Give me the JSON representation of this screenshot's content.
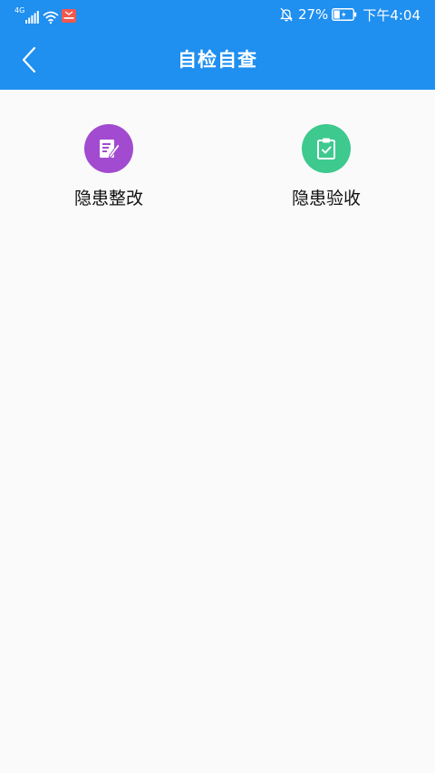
{
  "status_bar": {
    "network": "4G",
    "battery_percent": "27%",
    "time": "下午4:04",
    "icons": [
      "signal-icon",
      "wifi-icon",
      "app-badge-icon",
      "bell-off-icon",
      "battery-icon"
    ]
  },
  "header": {
    "title": "自检自查",
    "back_icon": "chevron-left-icon"
  },
  "menu": {
    "items": [
      {
        "label": "隐患整改",
        "icon": "edit-document-icon",
        "color": "#a24bd0"
      },
      {
        "label": "隐患验收",
        "icon": "clipboard-check-icon",
        "color": "#3ec98e"
      }
    ]
  },
  "colors": {
    "accent": "#1f8ff0",
    "background": "#fafafa"
  }
}
